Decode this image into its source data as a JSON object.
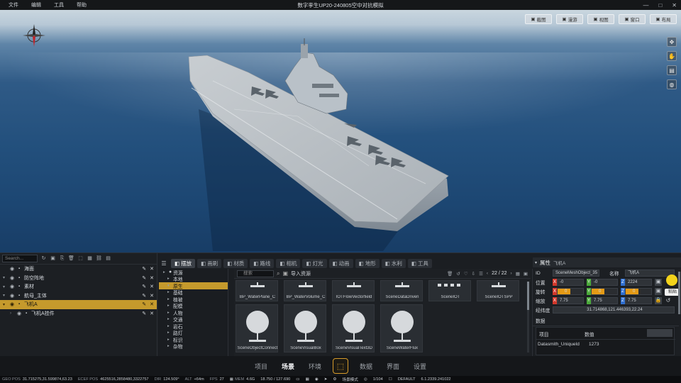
{
  "window": {
    "title": "数字孪生UP20-240805空中对抗模拟",
    "menu": [
      "文件",
      "编辑",
      "工具",
      "帮助"
    ],
    "controls": [
      "—",
      "□",
      "✕"
    ]
  },
  "viewport": {
    "toolbar": [
      {
        "icon": "camera-icon",
        "label": "截图"
      },
      {
        "icon": "video-icon",
        "label": "漫游"
      },
      {
        "icon": "frame-icon",
        "label": "视图"
      },
      {
        "icon": "window-icon",
        "label": "窗口"
      },
      {
        "icon": "layout-icon",
        "label": "布局"
      }
    ],
    "side_tools": [
      "move-icon",
      "hand-icon",
      "layers-icon",
      "globe-icon"
    ]
  },
  "outliner": {
    "search_placeholder": "Search...",
    "rows": [
      {
        "label": "海面",
        "selected": false,
        "expandable": false
      },
      {
        "label": "防空阵地",
        "selected": false,
        "expandable": true
      },
      {
        "label": "素材",
        "selected": false,
        "expandable": true
      },
      {
        "label": "航母_主体",
        "selected": false,
        "expandable": true
      },
      {
        "label": "飞机A",
        "selected": true,
        "expandable": true
      },
      {
        "label": "飞机A挂件",
        "selected": false,
        "expandable": true
      }
    ]
  },
  "tabs": [
    {
      "label": "摆放",
      "active": true
    },
    {
      "label": "画刷",
      "active": false
    },
    {
      "label": "材质",
      "active": false
    },
    {
      "label": "路线",
      "active": false
    },
    {
      "label": "相机",
      "active": false
    },
    {
      "label": "灯光",
      "active": false
    },
    {
      "label": "动画",
      "active": false
    },
    {
      "label": "地形",
      "active": false
    },
    {
      "label": "水利",
      "active": false
    },
    {
      "label": "工具",
      "active": false
    }
  ],
  "tree": {
    "items": [
      {
        "label": "资源",
        "selected": false
      },
      {
        "label": "本地",
        "selected": false
      },
      {
        "label": "原生",
        "selected": true
      },
      {
        "label": "基础",
        "selected": false
      },
      {
        "label": "植被",
        "selected": false
      },
      {
        "label": "配模",
        "selected": false
      },
      {
        "label": "人物",
        "selected": false
      },
      {
        "label": "交通",
        "selected": false
      },
      {
        "label": "岩石",
        "selected": false
      },
      {
        "label": "路灯",
        "selected": false
      },
      {
        "label": "标识",
        "selected": false
      },
      {
        "label": "杂物",
        "selected": false
      }
    ]
  },
  "assets": {
    "search_placeholder": "搜索",
    "import_label": "导入资源",
    "page": "22 / 22",
    "row1": [
      "BP_WaterPlane_C",
      "BP_WaterVolume_C",
      "IOTFlowVectorfield",
      "SceneDataDriven",
      "SceneIOT",
      "SceneIOTSPP"
    ],
    "row2": [
      "SceneObjectConnect",
      "SceneVisualBox",
      "SceneVisualText3D",
      "SceneWaterFlux"
    ]
  },
  "properties": {
    "tab_label": "属性",
    "object_name": "飞机A",
    "id_label": "ID",
    "id_value": "SceneMeshObject_35",
    "name_label": "名称",
    "name_value": "飞机A",
    "position_label": "位置",
    "position": {
      "x": "-0",
      "y": "-0",
      "z": "2224"
    },
    "rotation_label": "旋转",
    "rotation": {
      "x": "0",
      "y": "0",
      "z": "0"
    },
    "rotation_fill": 0.5,
    "scale_label": "缩放",
    "scale": {
      "x": "7.75",
      "y": "7.75",
      "z": "7.75"
    },
    "lonlat_label": "经纬度",
    "lonlat_value": "31.714868,121.446393,22.24",
    "data_label": "数据",
    "table_col1": "项目",
    "table_col2": "数值",
    "row_key": "Datasmith_UniqueId",
    "row_value": "1273",
    "paste_label": "粘贴"
  },
  "nav": {
    "items": [
      {
        "label": "项目",
        "active": false
      },
      {
        "label": "场景",
        "active": true
      },
      {
        "label": "环境",
        "active": false
      },
      {
        "label": "数据",
        "active": false
      },
      {
        "label": "界面",
        "active": false
      },
      {
        "label": "设置",
        "active": false
      }
    ],
    "logo_glyph": "⬚"
  },
  "status": {
    "geo_pos_label": "GEO POS",
    "geo_pos": "31.715275,31.599874,63.23",
    "ecef_label": "ECEF POS",
    "ecef": "4625516,2858480,3322757",
    "dir_label": "DIR",
    "dir": "124.509°",
    "alt_label": "ALT",
    "alt": "+64m",
    "fps_label": "FPS",
    "fps": "27",
    "mem_label": "MEM",
    "mem": "4.6G",
    "mem_usage": "18.750 / 127.690",
    "mode_label": "场景模式",
    "counter": "1/104",
    "preset": "DEFAULT",
    "version": "6.1.2339.241022"
  }
}
